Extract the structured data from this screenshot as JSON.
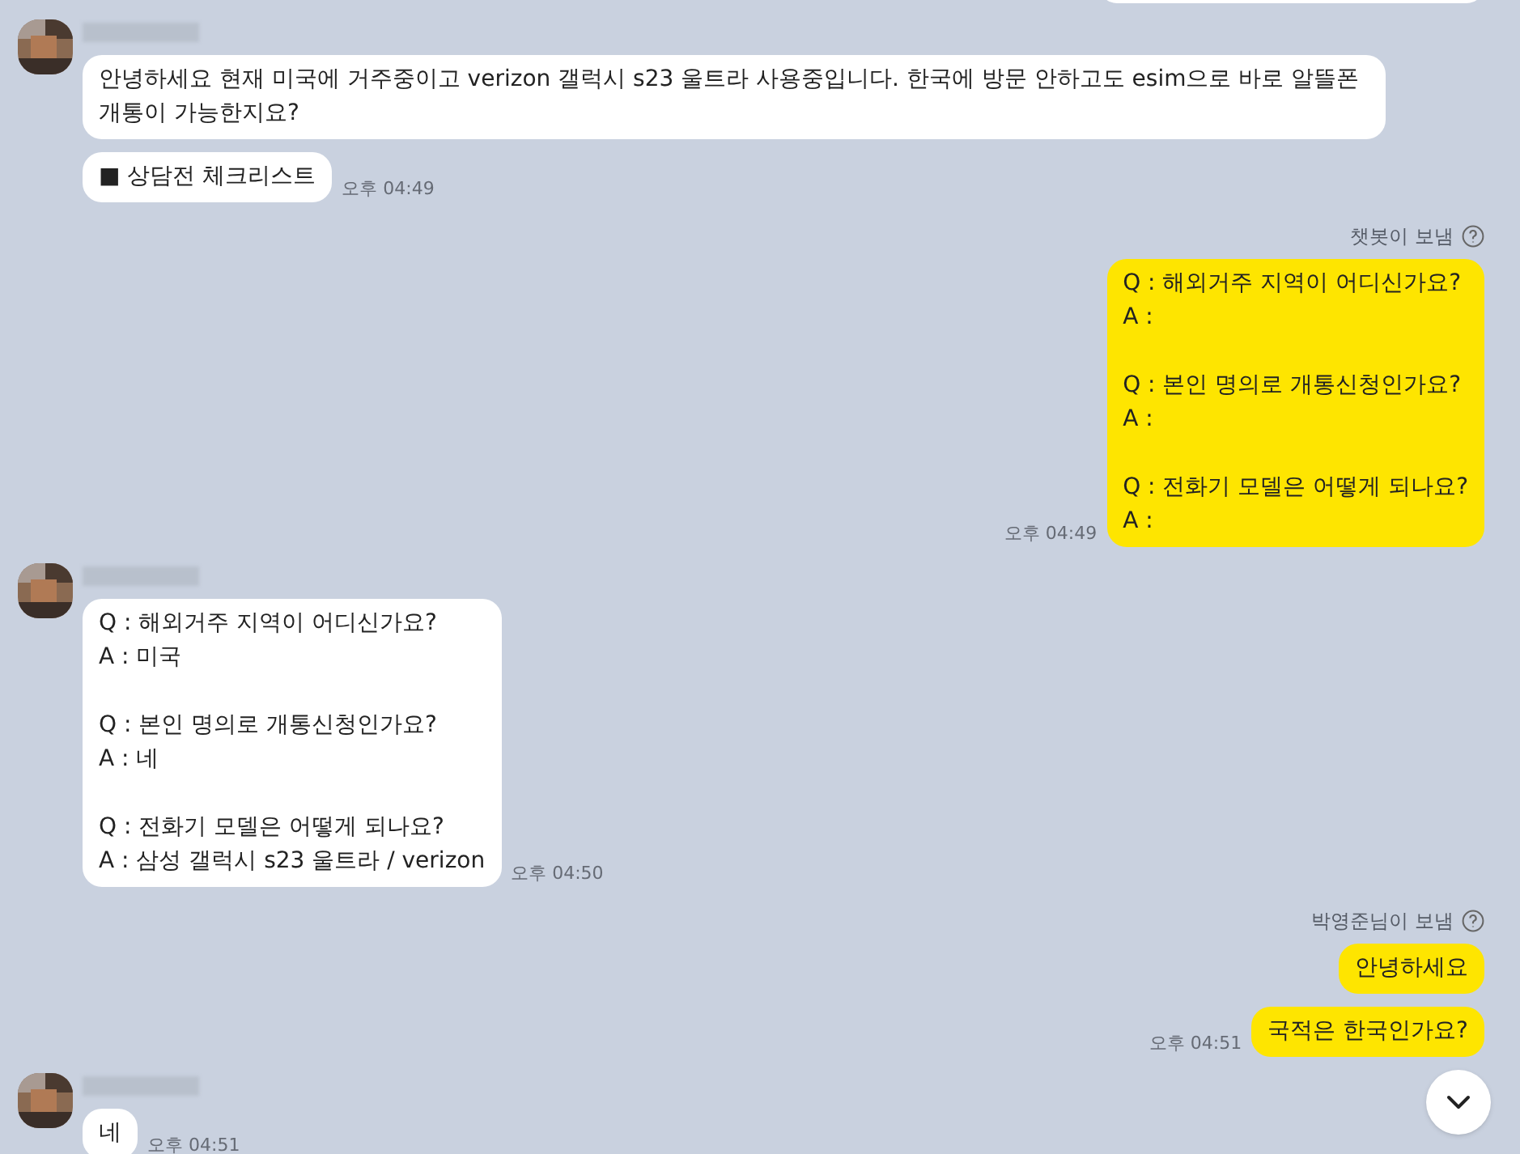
{
  "groups": [
    {
      "kind": "received",
      "messages": [
        {
          "text": "안녕하세요 현재 미국에 거주중이고 verizon 갤럭시 s23 울트라 사용중입니다. 한국에 방문 안하고도 esim으로 바로 알뜰폰 개통이 가능한지요?"
        },
        {
          "text": "■ 상담전 체크리스트",
          "time": "오후 04:49"
        }
      ]
    },
    {
      "kind": "sent",
      "sender": "챗봇이 보냄",
      "messages": [
        {
          "text": "Q : 해외거주 지역이 어디신가요?\nA :\n\nQ : 본인 명의로 개통신청인가요?\nA :\n\nQ : 전화기 모델은 어떻게 되나요?\nA :",
          "time": "오후 04:49"
        }
      ]
    },
    {
      "kind": "received",
      "messages": [
        {
          "text": "Q : 해외거주 지역이 어디신가요?\nA : 미국\n\nQ : 본인 명의로 개통신청인가요?\nA : 네\n\nQ : 전화기 모델은 어떻게 되나요?\nA : 삼성 갤럭시 s23 울트라 / verizon",
          "time": "오후 04:50"
        }
      ]
    },
    {
      "kind": "sent",
      "sender": "박영준님이 보냄",
      "messages": [
        {
          "text": "안녕하세요"
        },
        {
          "text": "국적은 한국인가요?",
          "time": "오후 04:51"
        }
      ]
    },
    {
      "kind": "received",
      "messages": [
        {
          "text": "네",
          "time": "오후 04:51"
        }
      ]
    }
  ]
}
